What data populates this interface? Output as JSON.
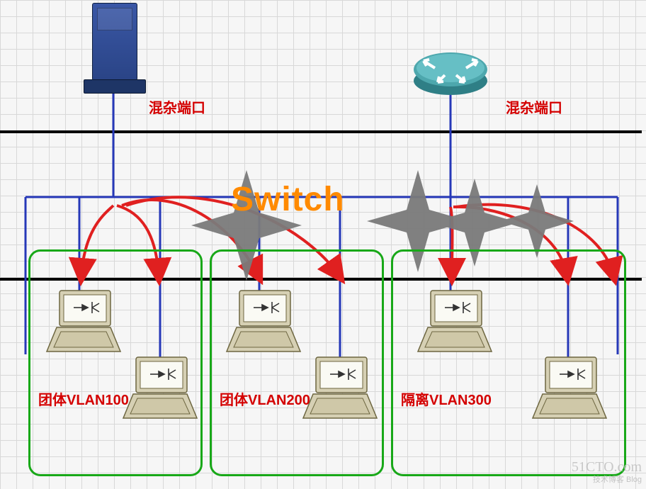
{
  "title": "Switch",
  "labels": {
    "promiscuous_left": "混杂端口",
    "promiscuous_right": "混杂端口",
    "vlan100": "团体VLAN100",
    "vlan200": "团体VLAN200",
    "vlan300": "隔离VLAN300"
  },
  "watermark": {
    "line1": "51CTO.com",
    "line2": "技术博客   Blog"
  },
  "colors": {
    "grid": "#d8d8d8",
    "accent_red": "#d40000",
    "switch_orange": "#ff8a00",
    "vlan_green": "#18a818",
    "link_blue": "#2638b8",
    "arrow_red": "#e02020",
    "star_gray": "#7a7a7a",
    "switch_border": "#000000"
  },
  "devices": {
    "server": {
      "type": "server",
      "role": "promiscuous"
    },
    "router": {
      "type": "router",
      "role": "promiscuous"
    },
    "hosts": 6
  },
  "vlans": [
    {
      "id": 100,
      "type": "community",
      "hosts": 2
    },
    {
      "id": 200,
      "type": "community",
      "hosts": 2
    },
    {
      "id": 300,
      "type": "isolated",
      "hosts": 2
    }
  ]
}
